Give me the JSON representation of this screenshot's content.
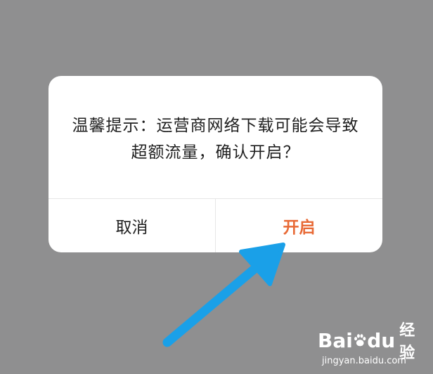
{
  "dialog": {
    "message_line1": "温馨提示：运营商网络下载可能会导致",
    "message_line2": "超额流量，确认开启？",
    "cancel_label": "取消",
    "confirm_label": "开启",
    "confirm_color": "#e86a36"
  },
  "overlay": {
    "backdrop_color": "#8f8f90",
    "arrow_color": "#1aa0e8"
  },
  "watermark": {
    "brand_prefix": "Bai",
    "brand_suffix": "du",
    "product": "经验",
    "url": "jingyan.baidu.com"
  }
}
